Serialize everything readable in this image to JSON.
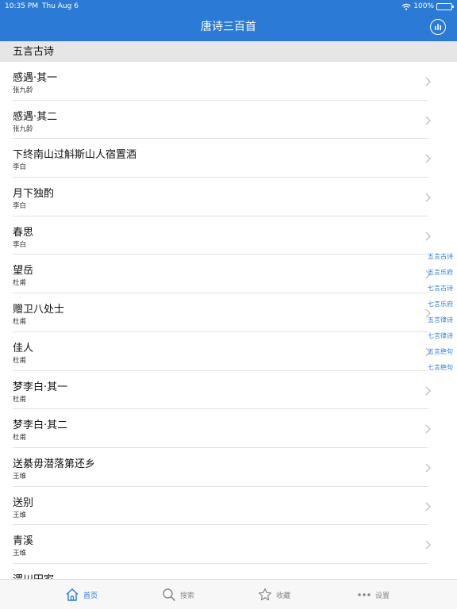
{
  "status": {
    "time": "10:35 PM",
    "date": "Thu Aug 6",
    "battery": "100%",
    "battery_level": 1.0
  },
  "nav": {
    "title": "唐诗三百首"
  },
  "section": {
    "title": "五言古诗"
  },
  "poems": [
    {
      "title": "感遇·其一",
      "author": "张九龄"
    },
    {
      "title": "感遇·其二",
      "author": "张九龄"
    },
    {
      "title": "下终南山过斛斯山人宿置酒",
      "author": "李白"
    },
    {
      "title": "月下独酌",
      "author": "李白"
    },
    {
      "title": "春思",
      "author": "李白"
    },
    {
      "title": "望岳",
      "author": "杜甫"
    },
    {
      "title": "赠卫八处士",
      "author": "杜甫"
    },
    {
      "title": "佳人",
      "author": "杜甫"
    },
    {
      "title": "梦李白·其一",
      "author": "杜甫"
    },
    {
      "title": "梦李白·其二",
      "author": "杜甫"
    },
    {
      "title": "送綦毋潜落第还乡",
      "author": "王维"
    },
    {
      "title": "送别",
      "author": "王维"
    },
    {
      "title": "青溪",
      "author": "王维"
    },
    {
      "title": "渭川田家",
      "author": ""
    }
  ],
  "index": [
    "五言古诗",
    "五言乐府",
    "七言古诗",
    "七言乐府",
    "五言律诗",
    "七言律诗",
    "五言绝句",
    "七言绝句"
  ],
  "tabs": [
    {
      "label": "首页",
      "icon": "home-icon",
      "active": true
    },
    {
      "label": "搜索",
      "icon": "search-icon",
      "active": false
    },
    {
      "label": "收藏",
      "icon": "star-icon",
      "active": false
    },
    {
      "label": "设置",
      "icon": "more-icon",
      "active": false
    }
  ],
  "colors": {
    "accent": "#2b7bd6",
    "section_bg": "#e6e6e6",
    "tab_inactive": "#888888"
  }
}
